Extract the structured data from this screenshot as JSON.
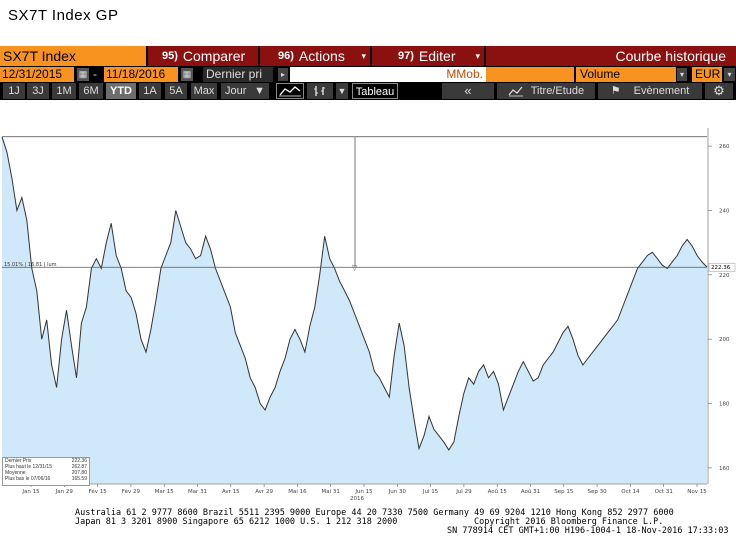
{
  "window_title": "SX7T Index GP",
  "toolbar1": {
    "ticker": "SX7T Index",
    "comparer_num": "95)",
    "comparer_label": "Comparer",
    "actions_num": "96)",
    "actions_label": "Actions",
    "editer_num": "97)",
    "editer_label": "Editer",
    "caret": "▾",
    "courbe_label": "Courbe historique"
  },
  "toolbar2": {
    "start_date": "12/31/2015",
    "end_date": "11/18/2016",
    "dash": "-",
    "field": "Dernier pri",
    "mmob": "MMob.",
    "volume": "Volume",
    "currency": "EUR"
  },
  "toolbar3": {
    "periods": [
      "1J",
      "3J",
      "1M",
      "6M",
      "YTD",
      "1A",
      "5A",
      "Max"
    ],
    "active_period": "YTD",
    "frequency": "Jour",
    "tableau": "Tableau",
    "titre_etude": "Titre/Etude",
    "evenement": "Evènement"
  },
  "legend": {
    "rows": [
      {
        "label": "Dernier Prix",
        "value": "222.36"
      },
      {
        "label": "Plus haut le 12/31/15",
        "value": "262.87"
      },
      {
        "label": "Moyenne",
        "value": "207.80"
      },
      {
        "label": "Plus bas le 07/06/16",
        "value": "165.59"
      }
    ]
  },
  "current_label": "222.36",
  "hline_label": "15.01% | 16.81 | lum",
  "chart_data": {
    "type": "area",
    "ylim": [
      155,
      265
    ],
    "y_ticks": [
      160,
      180,
      200,
      220,
      240,
      260
    ],
    "x_ticks": [
      "Jan 15",
      "Jan 29",
      "Fév 15",
      "Fév 29",
      "Mar 15",
      "Mar 31",
      "Avr 15",
      "Avr 29",
      "Mai 16",
      "Mai 31",
      "Jun 15",
      "Jun 30",
      "Jul 15",
      "Jul 29",
      "Aoû 15",
      "Aoû 31",
      "Sep 15",
      "Sep 30",
      "Oct 14",
      "Oct 31",
      "Nov 15"
    ],
    "year_label": "2016",
    "series": [
      {
        "values": [
          262.9,
          258,
          250,
          240,
          244,
          237,
          222,
          215,
          200,
          206,
          192,
          185,
          200,
          209,
          198,
          188,
          205,
          210,
          222,
          225,
          222,
          230,
          236,
          226,
          222,
          215,
          213,
          208,
          200,
          196,
          203,
          212,
          222,
          226,
          230,
          240,
          235,
          230,
          228,
          225,
          226,
          232,
          228,
          222,
          218,
          214,
          210,
          202,
          198,
          194,
          188,
          185,
          180,
          178,
          182,
          185,
          190,
          194,
          200,
          203,
          200,
          196,
          204,
          210,
          220,
          232,
          225,
          222,
          218,
          215,
          212,
          208,
          204,
          200,
          196,
          190,
          188,
          185,
          182,
          195,
          205,
          198,
          185,
          175,
          166,
          170,
          176,
          172,
          170,
          168,
          165.6,
          168,
          176,
          183,
          188,
          186,
          190,
          192,
          188,
          190,
          186,
          178,
          182,
          186,
          190,
          193,
          190,
          187,
          188,
          192,
          194,
          196,
          199,
          202,
          204,
          200,
          195,
          192,
          194,
          196,
          198,
          200,
          202,
          204,
          206,
          210,
          214,
          218,
          222,
          224,
          226,
          227,
          225,
          223,
          222,
          224,
          226,
          229,
          231,
          229,
          226,
          224,
          222.4
        ]
      }
    ]
  },
  "footer": {
    "line1": "Australia 61 2 9777 8600 Brazil 5511 2395 9000 Europe 44 20 7330 7500 Germany 49 69 9204 1210 Hong Kong 852 2977 6000",
    "line2a": "Japan 81 3 3201 8900          Singapore 65 6212 1000          U.S. 1 212 318 2000",
    "line2b": "Copyright 2016 Bloomberg Finance L.P.",
    "line3": "SN 778914 CET  GMT+1:00 H196-1004-1 18-Nov-2016 17:33:03"
  }
}
